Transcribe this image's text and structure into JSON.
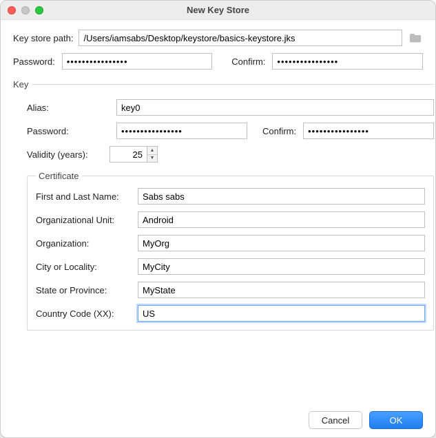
{
  "title": "New Key Store",
  "labels": {
    "path": "Key store path:",
    "password": "Password:",
    "confirm": "Confirm:",
    "key_legend": "Key",
    "alias": "Alias:",
    "validity": "Validity (years):",
    "cert_legend": "Certificate",
    "cert_name": "First and Last Name:",
    "cert_ou": "Organizational Unit:",
    "cert_org": "Organization:",
    "cert_city": "City or Locality:",
    "cert_state": "State or Province:",
    "cert_cc": "Country Code (XX):"
  },
  "values": {
    "path": "/Users/iamsabs/Desktop/keystore/basics-keystore.jks",
    "password": "••••••••••••••••",
    "confirm": "••••••••••••••••",
    "alias": "key0",
    "key_password": "••••••••••••••••",
    "key_confirm": "••••••••••••••••",
    "validity": "25",
    "cert_name": "Sabs sabs",
    "cert_ou": "Android",
    "cert_org": "MyOrg",
    "cert_city": "MyCity",
    "cert_state": "MyState",
    "cert_cc": "US"
  },
  "buttons": {
    "cancel": "Cancel",
    "ok": "OK"
  }
}
